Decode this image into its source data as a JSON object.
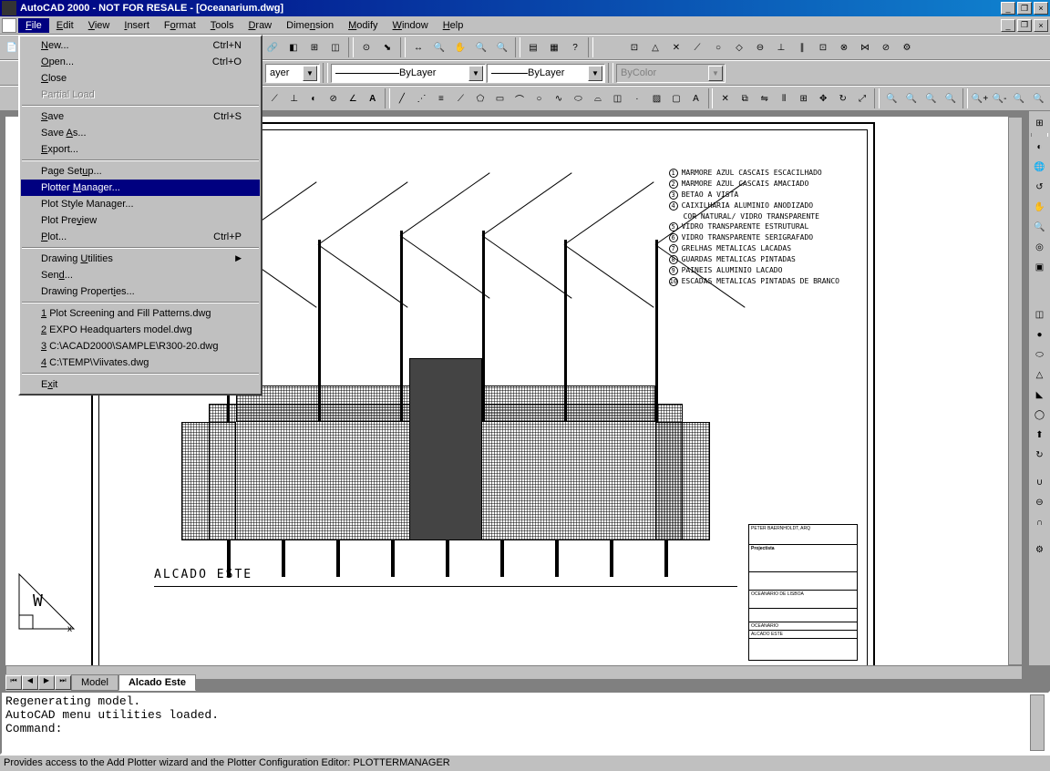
{
  "window": {
    "title": "AutoCAD 2000 - NOT FOR RESALE - [Oceanarium.dwg]"
  },
  "menubar": {
    "items": [
      "File",
      "Edit",
      "View",
      "Insert",
      "Format",
      "Tools",
      "Draw",
      "Dimension",
      "Modify",
      "Window",
      "Help"
    ]
  },
  "file_menu": {
    "items": [
      {
        "label": "New...",
        "shortcut": "Ctrl+N",
        "u": 0
      },
      {
        "label": "Open...",
        "shortcut": "Ctrl+O",
        "u": 0
      },
      {
        "label": "Close",
        "u": 0
      },
      {
        "label": "Partial Load",
        "disabled": true
      },
      {
        "sep": true
      },
      {
        "label": "Save",
        "shortcut": "Ctrl+S",
        "u": 0
      },
      {
        "label": "Save As...",
        "u": 5
      },
      {
        "label": "Export...",
        "u": 0
      },
      {
        "sep": true
      },
      {
        "label": "Page Setup...",
        "u": 8
      },
      {
        "label": "Plotter Manager...",
        "highlight": true,
        "u": 8
      },
      {
        "label": "Plot Style Manager...",
        "u": 16
      },
      {
        "label": "Plot Preview",
        "u": 6
      },
      {
        "label": "Plot...",
        "shortcut": "Ctrl+P",
        "u": 0
      },
      {
        "sep": true
      },
      {
        "label": "Drawing Utilities",
        "submenu": true,
        "u": 8
      },
      {
        "label": "Send...",
        "u": 3
      },
      {
        "label": "Drawing Properties...",
        "u": 7
      },
      {
        "sep": true
      },
      {
        "label": "1 Plot Screening and Fill Patterns.dwg",
        "u": 0
      },
      {
        "label": "2 EXPO Headquarters model.dwg",
        "u": 0
      },
      {
        "label": "3 C:\\ACAD2000\\SAMPLE\\R300-20.dwg",
        "u": 0
      },
      {
        "label": "4 C:\\TEMP\\Viivates.dwg",
        "u": 0
      },
      {
        "sep": true
      },
      {
        "label": "Exit",
        "u": 1
      }
    ]
  },
  "layer_dropdown": "ayer",
  "linetype_dropdown": "ByLayer",
  "lineweight_dropdown": "ByLayer",
  "color_dropdown": "ByColor",
  "tabs": {
    "nav": [
      "⏮",
      "◀",
      "▶",
      "⏭"
    ],
    "items": [
      {
        "label": "Model",
        "active": false
      },
      {
        "label": "Alcado Este",
        "active": true
      }
    ]
  },
  "cmdline": {
    "line1": "Regenerating model.",
    "line2": "AutoCAD menu utilities loaded.",
    "prompt": "Command:"
  },
  "statusbar": "Provides access to the Add Plotter wizard and the Plotter Configuration Editor:  PLOTTERMANAGER",
  "legend": [
    "MARMORE AZUL CASCAIS ESCACILHADO",
    "MARMORE AZUL CASCAIS AMACIADO",
    "BETAO A VISTA",
    "CAIXILHARIA ALUMINIO ANODIZADO",
    "COR NATURAL/ VIDRO TRANSPARENTE",
    "VIDRO TRANSPARENTE ESTRUTURAL",
    "VIDRO TRANSPARENTE SERIGRAFADO",
    "GRELHAS METALICAS LACADAS",
    "GUARDAS METALICAS PINTADAS",
    "PAINEIS ALUMINIO LACADO",
    "ESCADAS METALICAS PINTADAS DE BRANCO"
  ],
  "drawing_title": "ALCADO ESTE",
  "titleblock": {
    "l1": "PETER BAERNHOLDT, ARQ",
    "l2": "Projectista",
    "l3": "OCEANARIO DE LISBOA",
    "l4": "OCEANARIO",
    "l5": "ALCADO ESTE"
  }
}
